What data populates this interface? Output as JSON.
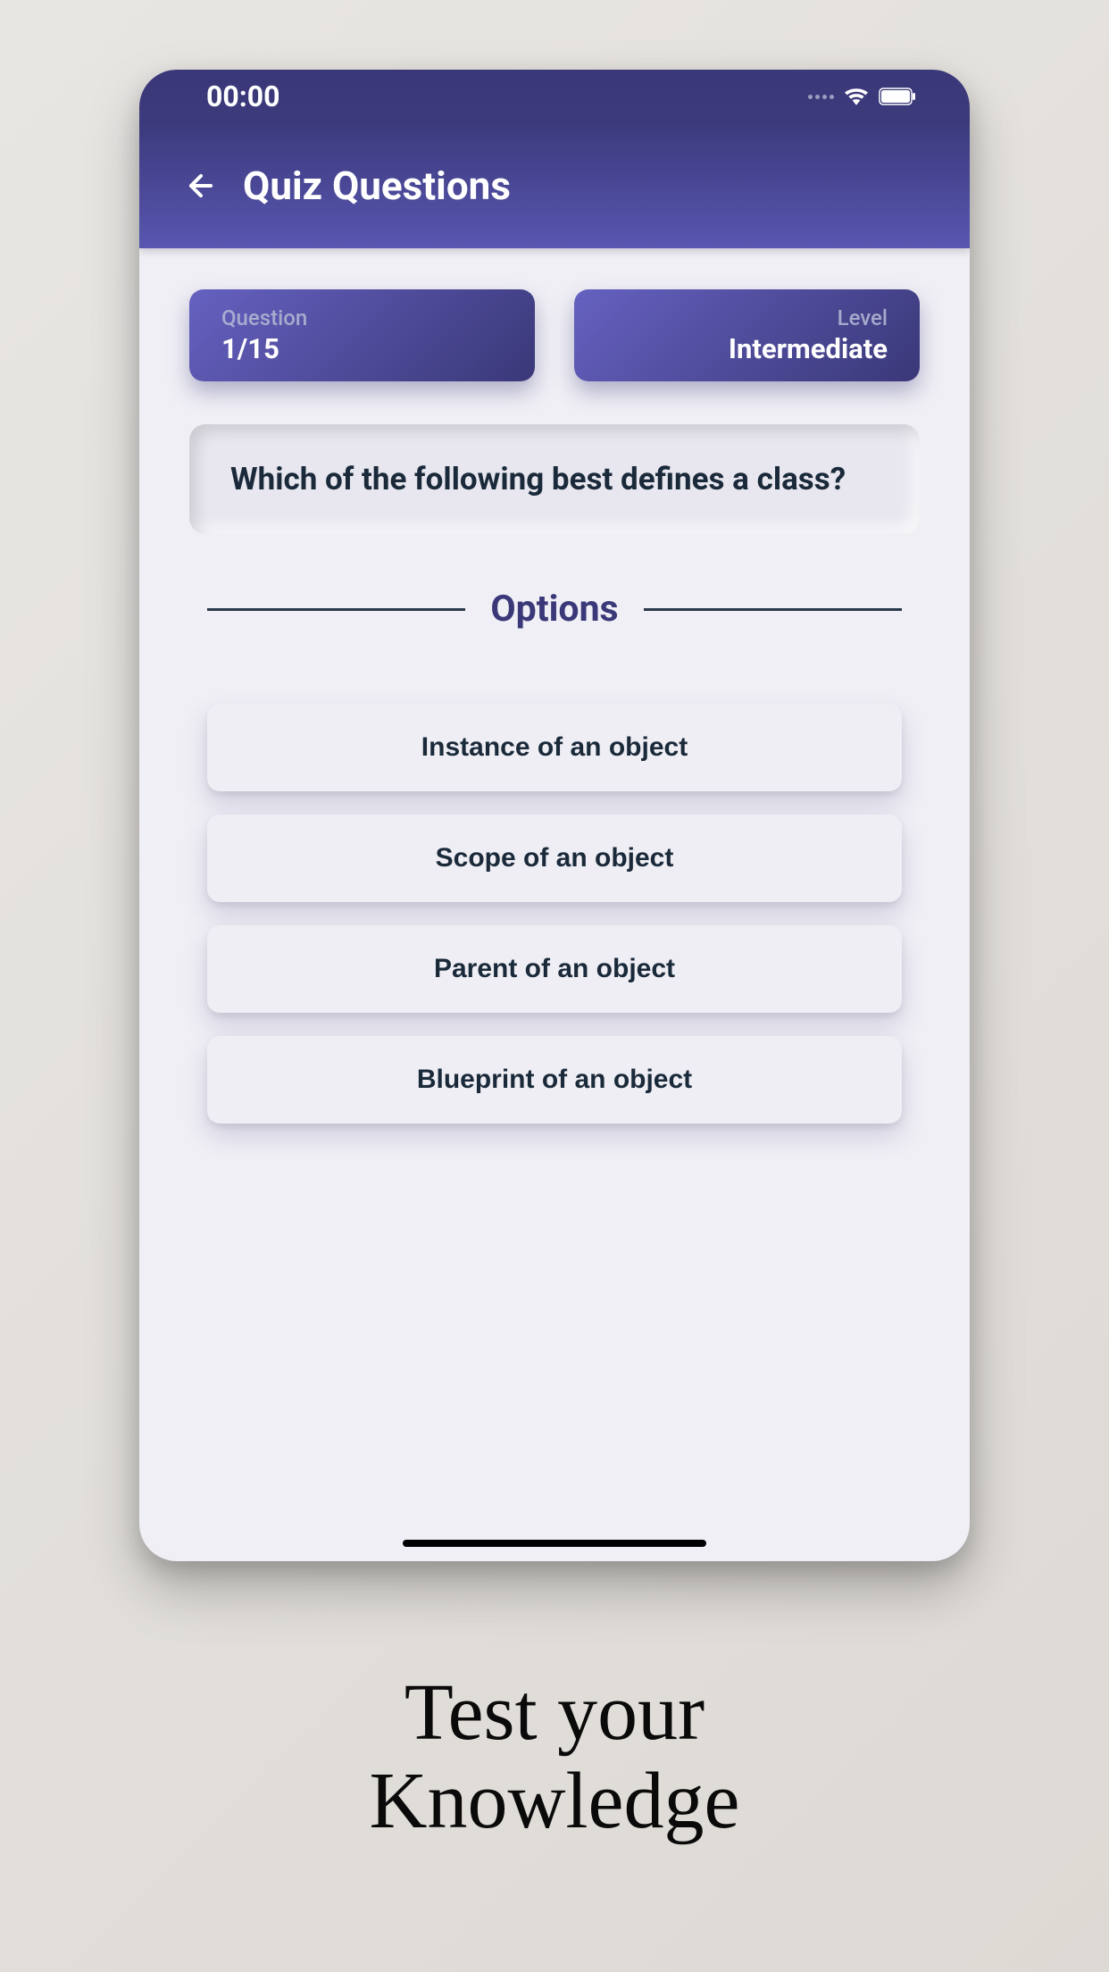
{
  "status": {
    "time": "00:00"
  },
  "header": {
    "title": "Quiz Questions"
  },
  "info": {
    "question_label": "Question",
    "question_value": "1/15",
    "level_label": "Level",
    "level_value": "Intermediate"
  },
  "question": {
    "text": "Which of the following best defines a class?"
  },
  "options": {
    "label": "Options",
    "items": [
      "Instance of an object",
      "Scope of an object",
      "Parent of an object",
      "Blueprint of an object"
    ]
  },
  "tagline": {
    "line1": "Test your",
    "line2": "Knowledge"
  }
}
